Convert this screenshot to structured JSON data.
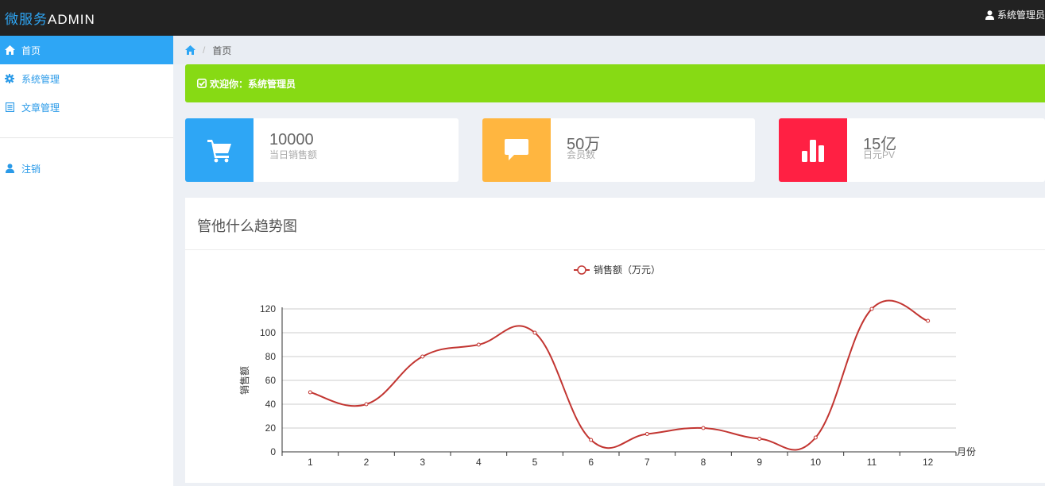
{
  "header": {
    "brand_part1": "微服务",
    "brand_part2": "ADMIN",
    "user_name": "系统管理员"
  },
  "sidebar": {
    "items": [
      {
        "label": "首页",
        "icon": "home-icon",
        "active": true
      },
      {
        "label": "系统管理",
        "icon": "gear-icon",
        "active": false
      },
      {
        "label": "文章管理",
        "icon": "document-list-icon",
        "active": false
      }
    ],
    "logout": {
      "label": "注销",
      "icon": "user-icon"
    }
  },
  "breadcrumb": {
    "home_icon": "home-icon",
    "current": "首页"
  },
  "welcome": {
    "text": "欢迎你：系统管理员",
    "icon": "check-square-icon",
    "color": "#87da14"
  },
  "stats": [
    {
      "value": "10000",
      "label": "当日销售额",
      "icon": "shopping-cart-icon",
      "color": "#2ea6f5"
    },
    {
      "value": "50万",
      "label": "会员数",
      "icon": "comment-icon",
      "color": "#ffb640"
    },
    {
      "value": "15亿",
      "label": "日元PV",
      "icon": "bar-chart-icon",
      "color": "#ff2043"
    }
  ],
  "panel": {
    "title": "管他什么趋势图"
  },
  "chart_data": {
    "type": "line",
    "title": "",
    "x": [
      "1",
      "2",
      "3",
      "4",
      "5",
      "6",
      "7",
      "8",
      "9",
      "10",
      "11",
      "12"
    ],
    "series": [
      {
        "name": "销售额（万元）",
        "values": [
          50,
          40,
          80,
          90,
          100,
          10,
          15,
          20,
          11,
          12,
          120,
          110
        ],
        "color": "#c23531"
      }
    ],
    "xlabel": "月份",
    "ylabel": "销售额",
    "ylim": [
      0,
      120
    ],
    "yticks": [
      0,
      20,
      40,
      60,
      80,
      100,
      120
    ],
    "smooth": true,
    "grid": true,
    "legend": "top-center"
  }
}
